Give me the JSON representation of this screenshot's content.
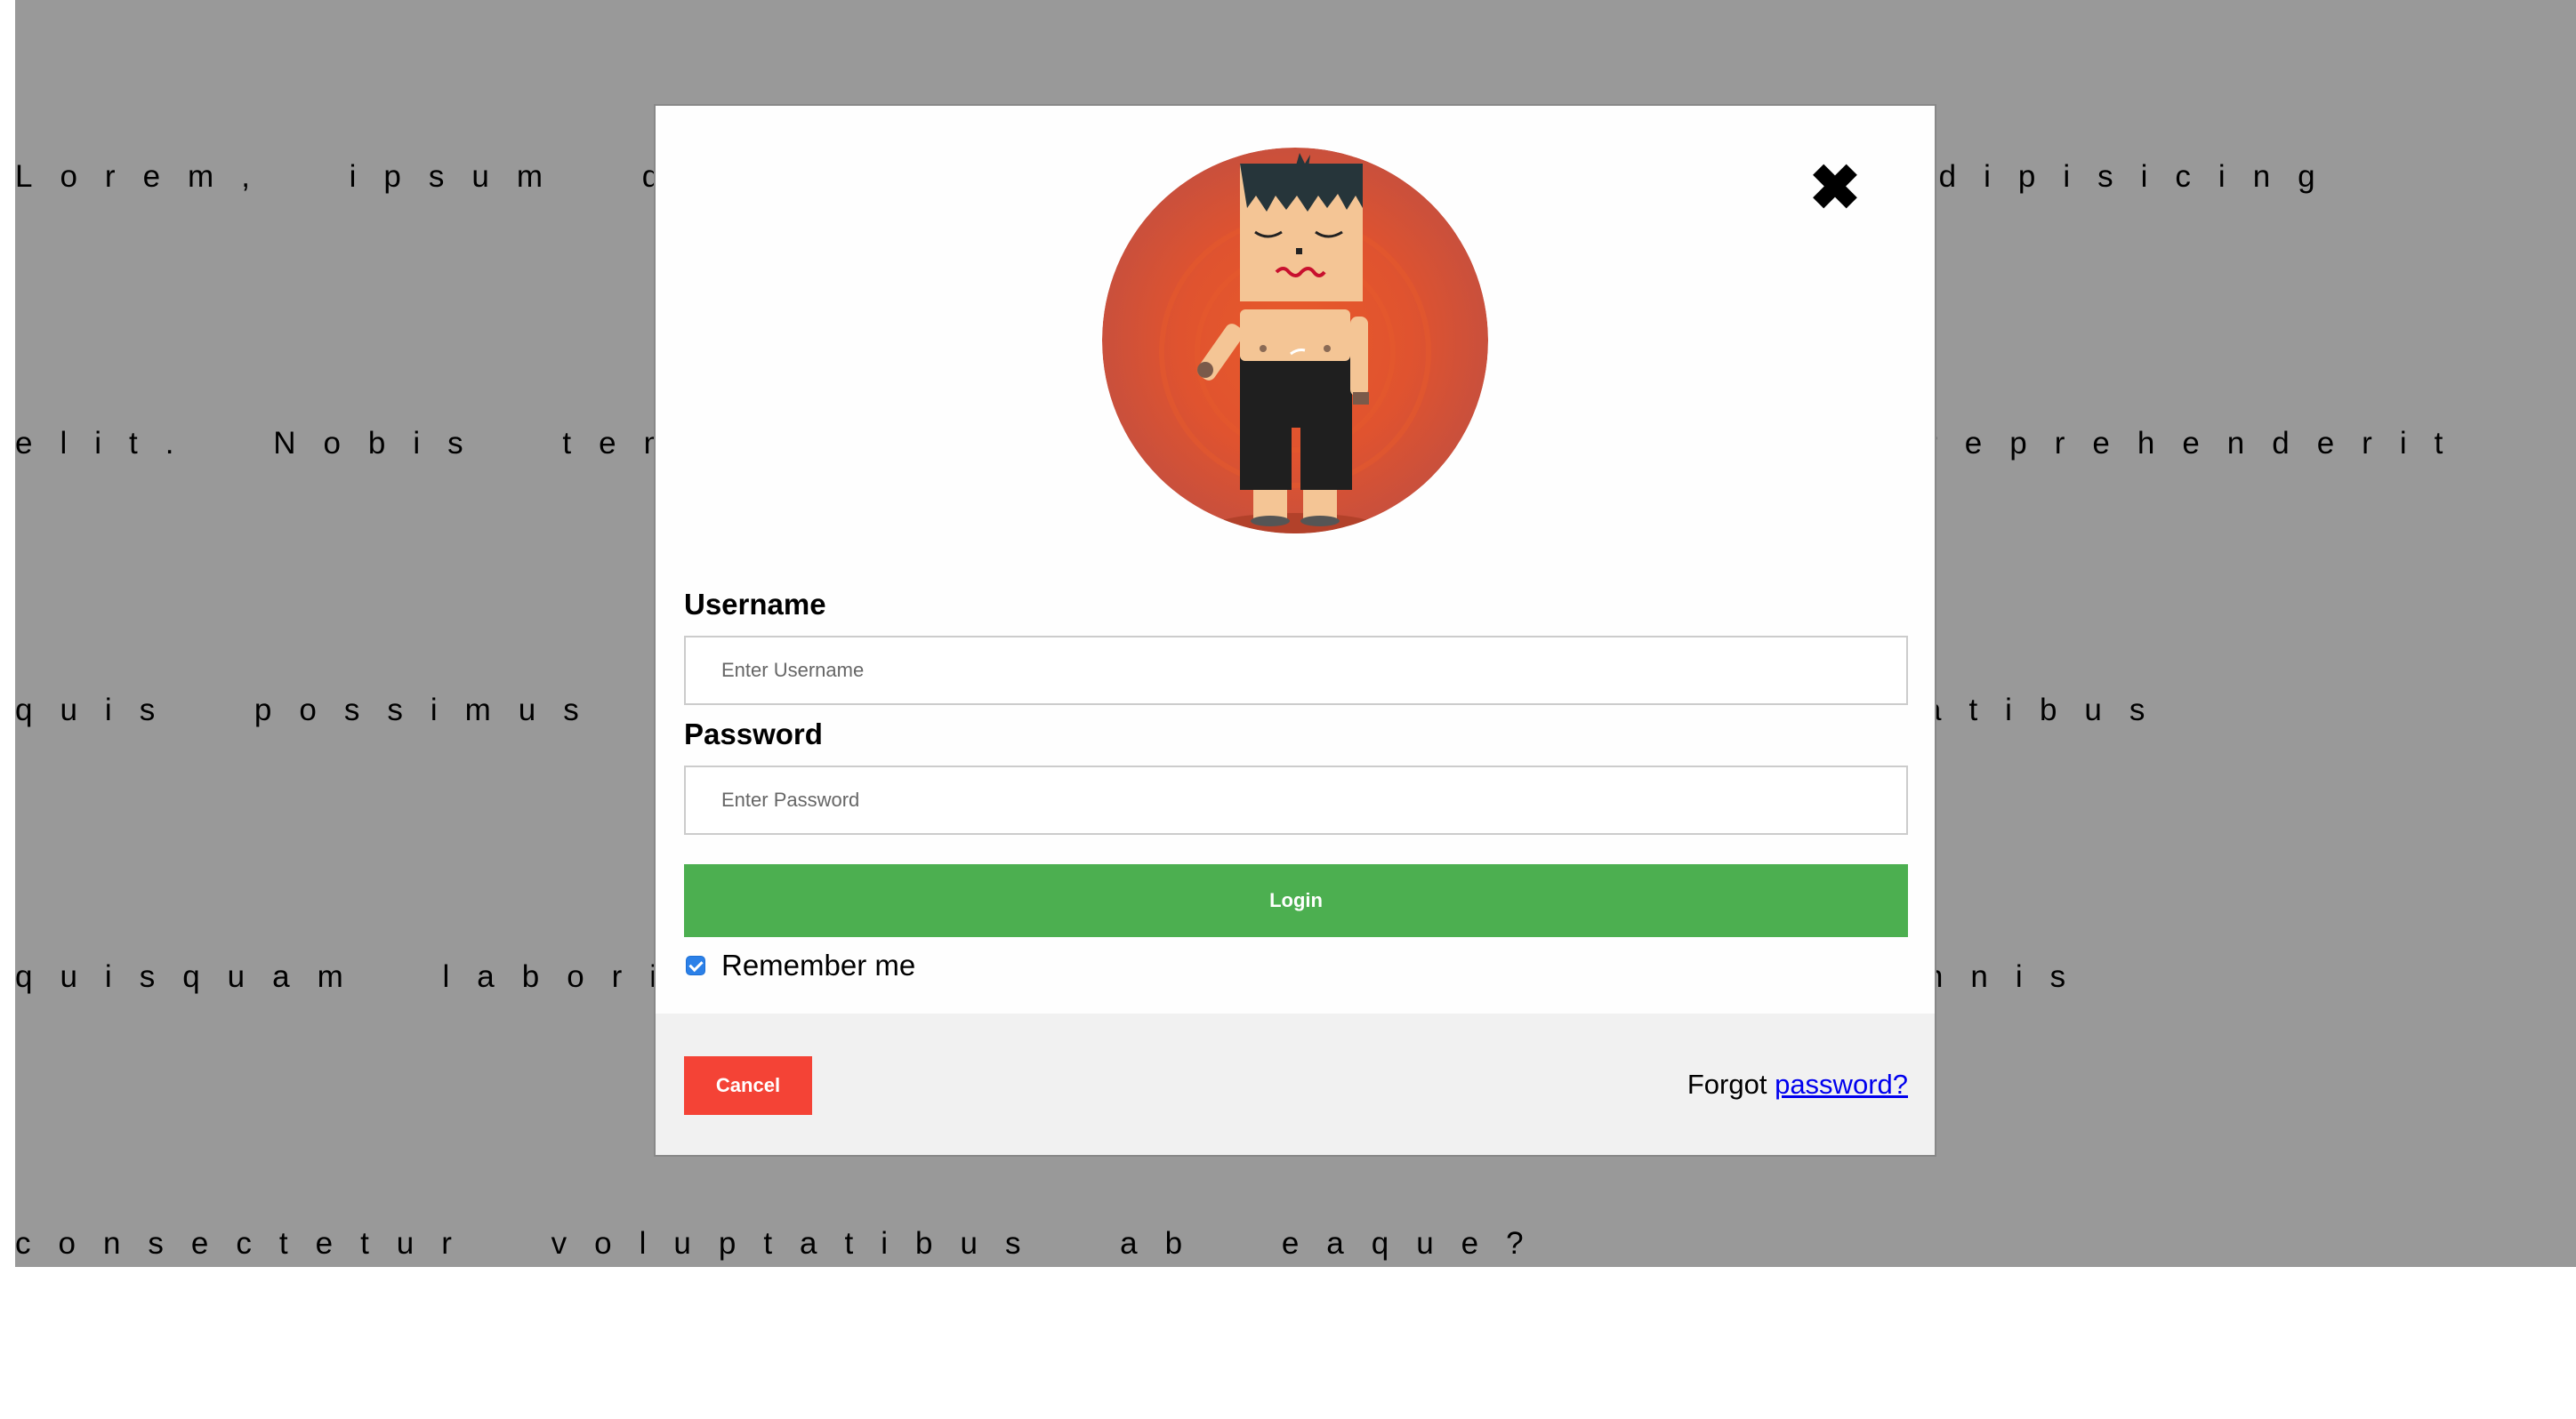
{
  "background_text": {
    "line1": "Lorem, ipsum dolor sit amet consectetur adipisicing",
    "line2": "elit. Nobis tempora unde facere sapiente reprehenderit",
    "line3": "quis possimus dolores aliquid nulla voluptatibus",
    "line4": "quisquam laboriosam corrupti sed natus. Omnis",
    "line5": "consectetur voluptatibus ab eaque?"
  },
  "modal": {
    "close_label": "✖",
    "avatar_icon": "avatar-image",
    "username_label": "Username",
    "username_placeholder": "Enter Username",
    "password_label": "Password",
    "password_placeholder": "Enter Password",
    "login_label": "Login",
    "remember_label": "Remember me",
    "remember_checked": true,
    "footer": {
      "cancel_label": "Cancel",
      "forgot_text": "Forgot",
      "forgot_link": "password?"
    }
  },
  "colors": {
    "backdrop": "#999999",
    "login": "#4caf50",
    "cancel": "#f44336",
    "link": "#0000ee"
  }
}
